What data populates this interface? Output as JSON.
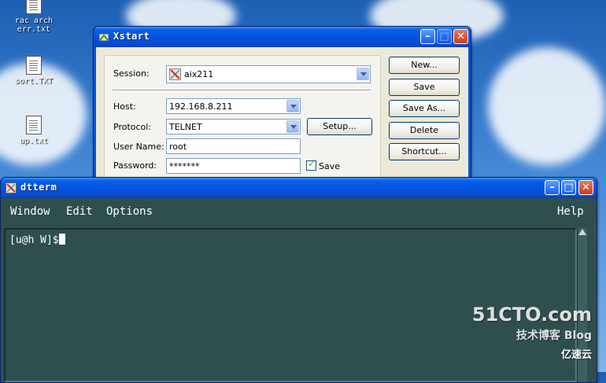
{
  "desktop": {
    "icons": [
      {
        "label_line1": "rac arch",
        "label_line2": "err.txt"
      },
      {
        "label_line1": "sort.TXT",
        "label_line2": ""
      },
      {
        "label_line1": "up.txt",
        "label_line2": ""
      }
    ]
  },
  "xstart": {
    "title": "Xstart",
    "session_label": "Session:",
    "session_value": "aix211",
    "host_label": "Host:",
    "host_value": "192.168.8.211",
    "protocol_label": "Protocol:",
    "protocol_value": "TELNET",
    "setup_button": "Setup...",
    "username_label": "User Name:",
    "username_value": "root",
    "password_label": "Password:",
    "password_value": "*******",
    "save_checkbox_label": "Save",
    "buttons": {
      "new": "New...",
      "save": "Save",
      "save_as": "Save As...",
      "delete": "Delete",
      "shortcut": "Shortcut..."
    }
  },
  "dtterm": {
    "title": "dtterm",
    "menu": {
      "window": "Window",
      "edit": "Edit",
      "options": "Options",
      "help": "Help"
    },
    "prompt": "[u@h W]$",
    "background_color": "#2f4f4f"
  },
  "watermark": {
    "line1": "51CTO.com",
    "line2": "技术博客 Blog",
    "brand": "亿速云"
  },
  "colors": {
    "titlebar": "#0054e3",
    "dialog_bg": "#ece9d8"
  }
}
